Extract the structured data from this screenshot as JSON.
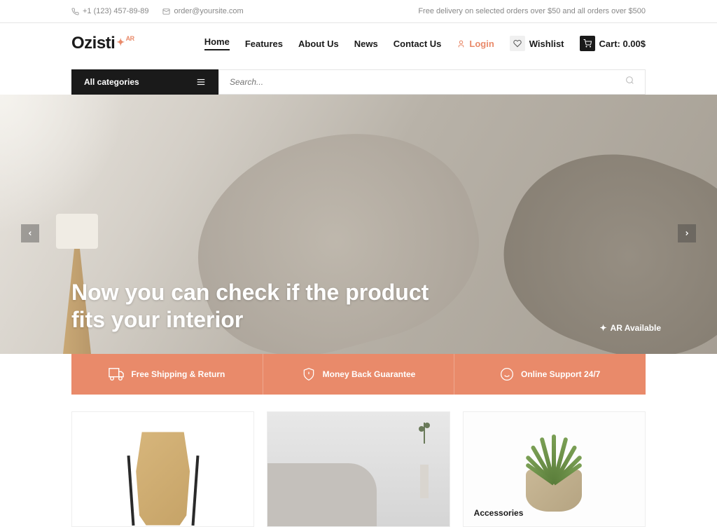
{
  "topbar": {
    "phone": "+1 (123) 457-89-89",
    "email": "order@yoursite.com",
    "delivery_notice": "Free delivery on selected orders over $50 and all orders over $500"
  },
  "logo": {
    "text": "Ozisti",
    "badge": "AR"
  },
  "nav": {
    "home": "Home",
    "features": "Features",
    "about": "About Us",
    "news": "News",
    "contact": "Contact Us",
    "login": "Login",
    "wishlist": "Wishlist",
    "cart": "Cart: 0.00$"
  },
  "searchbar": {
    "categories_label": "All categories",
    "placeholder": "Search..."
  },
  "hero": {
    "title_line1": "Now you can check if the product",
    "title_line2": "fits your interior",
    "ar_label": "AR Available"
  },
  "features": {
    "shipping": "Free Shipping & Return",
    "moneyback": "Money Back Guarantee",
    "support": "Online Support 24/7"
  },
  "cards": {
    "accessories_label": "Accessories"
  }
}
